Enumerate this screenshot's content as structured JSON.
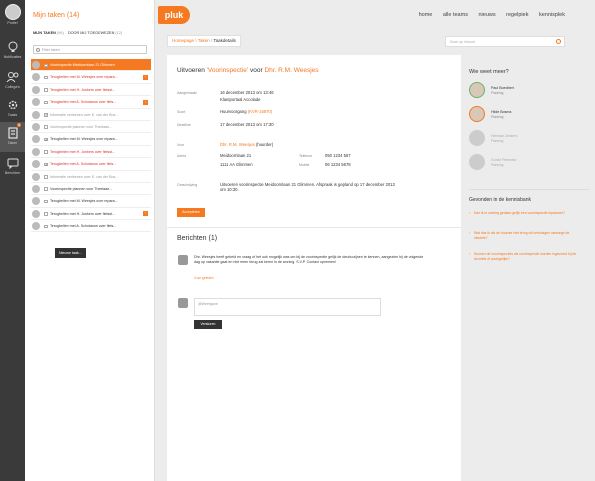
{
  "nav": {
    "items": [
      {
        "label": "Profiel",
        "icon": "avatar"
      },
      {
        "label": "Notificaties",
        "icon": "lightbulb-icon"
      },
      {
        "label": "Collega's",
        "icon": "people-icon"
      },
      {
        "label": "Taaks",
        "icon": "gear-icon"
      },
      {
        "label": "Taken",
        "icon": "tasks-icon",
        "badge": "4"
      },
      {
        "label": "Berichten",
        "icon": "chat-icon"
      }
    ]
  },
  "tasks": {
    "title": "Mijn taken (14)",
    "tab_mine": "MIJN TAKEN",
    "tab_mine_count": "(96)",
    "tab_assigned": "DOOR MIJ TOEGEWEZEN",
    "tab_assigned_count": "(12)",
    "filter_placeholder": "Filter taken",
    "items": [
      {
        "text": "Voorinspectie Meidoornlaan 21 Glimmen",
        "style": "hl",
        "check": ""
      },
      {
        "text": "Terugbellen met M. Weesjes over repara...",
        "style": "red",
        "check": "",
        "flag": "!"
      },
      {
        "text": "Terugbellen met H. Jonkers over fietsst...",
        "style": "red",
        "check": ""
      },
      {
        "text": "Terugbellen met A. Schotanus over fiets...",
        "style": "red",
        "check": "",
        "flag": "!"
      },
      {
        "text": "Informatie verleenen over E. van der Bos...",
        "style": "grey",
        "check": "✓"
      },
      {
        "text": "Voorinspectie plannen voor Theelaan...",
        "style": "grey",
        "check": ""
      },
      {
        "text": "Terugbellen met M. Weesjes over repara...",
        "style": "",
        "check": "✓"
      },
      {
        "text": "Terugbellen met H. Jonkers over fietsst...",
        "style": "red",
        "check": ""
      },
      {
        "text": "Terugbellen met A. Schotanus over fiets...",
        "style": "red",
        "check": "✓"
      },
      {
        "text": "Informatie verleenen over E. van der Bos...",
        "style": "grey",
        "check": ""
      },
      {
        "text": "Voorinspectie plannen voor Theelaan...",
        "style": "",
        "check": ""
      },
      {
        "text": "Terugbellen met M. Weesjes over repara...",
        "style": "",
        "check": ""
      },
      {
        "text": "Terugbellen met H. Jonkers over fietsst...",
        "style": "",
        "check": "",
        "flag": "!"
      },
      {
        "text": "Terugbellen met A. Schotanus over fiets...",
        "style": "",
        "check": ""
      }
    ],
    "new_task_button": "Nieuwe taak..."
  },
  "header": {
    "logo": "pluk",
    "nav": [
      "home",
      "alle teams",
      "nieuws",
      "regelpiek",
      "kennisplek"
    ],
    "search_placeholder": "Zoek op inhoud"
  },
  "breadcrumb": {
    "home": "Homepage",
    "tasks": "Taken",
    "current": "Taakdetails"
  },
  "detail": {
    "title_prefix": "Uitvoeren",
    "title_subject": "'Voorinspectie'",
    "title_middle": "voor",
    "title_person": "Dhr. R.M. Weesjes",
    "rows": [
      {
        "label": "Aangemaakt",
        "value": "16 december 2013 om 13:46"
      },
      {
        "label": "",
        "value": "Klantportaal Accolade"
      },
      {
        "label": "Soort",
        "value": "Huurvoorgang"
      },
      {
        "label": "Deadline",
        "value": "17 december 2013 om 17:30"
      }
    ],
    "soort_extra": "(KVR-16870)",
    "for_label": "Voor",
    "for_value": "Dhr. R.M. Weesjes",
    "for_role": "(huurder)",
    "adres_label": "Adres",
    "adres_line1": "Meidoornlaan 21",
    "adres_line2": "1111 AA Glimmen",
    "phone_label": "Telefoon",
    "phone_value": "050 1234 567",
    "mobile_label": "Mobiel",
    "mobile_value": "06 1234 5678",
    "desc_label": "Omschrijving",
    "desc_value": "Uitvoeren voorinspectie Meidoornlaan 21 Glimmen. Afspraak is gepland op 17 december 2013 om 10:30.",
    "action_button": "Accepteren"
  },
  "messages": {
    "title": "Berichten (1)",
    "text": "Dhr. Weesjes heeft gebeld en vraag of het ook mogelijk was om bij de voorinspectie gelijk de deurkozijnen te kennen, aangezien hij de volgende dag op vakantie gaat en niet meer terug zal keren in de woning. S.V.P. Contact opnemen!",
    "time": "4 uur geleden",
    "reply_placeholder": "@Weergave",
    "reply_button": "Versturen"
  },
  "sidebar": {
    "who_title": "Wie weet meer?",
    "people": [
      {
        "name": "Paul Boedbert",
        "role": "Planning",
        "style": "green"
      },
      {
        "name": "Hilde Bosma",
        "role": "Planning",
        "style": "orange"
      },
      {
        "name": "Herman Jonkers",
        "role": "Planning",
        "style": "faded"
      },
      {
        "name": "Gunar Feenstra",
        "role": "Planning",
        "style": "faded"
      }
    ],
    "kb_title": "Gevonden in de kennisbank",
    "kb_items": [
      "Kan ik in overleg gedaan gelijk een voorinspectie inplannen?",
      "Wat doe ik als de huurder niet terug wil verhuisgen vanwege de sleutels?",
      "Kunnen de voorinspecties als voorinspectie worden ingevoerd bij de Archiefs of soortgelijke?"
    ]
  }
}
